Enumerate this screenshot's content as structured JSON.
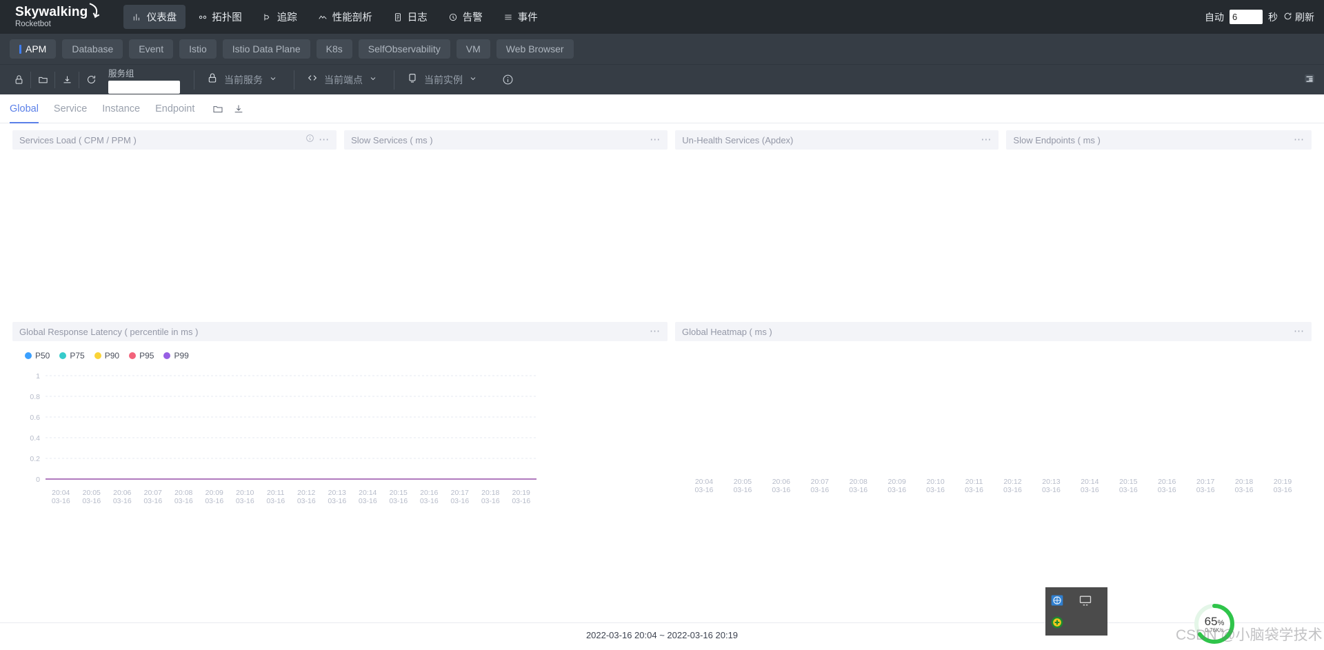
{
  "header": {
    "brand_name": "Skywalking",
    "brand_sub": "Rocketbot",
    "nav": [
      {
        "label": "仪表盘",
        "icon": "dashboard-icon",
        "active": true
      },
      {
        "label": "拓扑图",
        "icon": "topology-icon",
        "active": false
      },
      {
        "label": "追踪",
        "icon": "trace-icon",
        "active": false
      },
      {
        "label": "性能剖析",
        "icon": "profile-icon",
        "active": false
      },
      {
        "label": "日志",
        "icon": "log-icon",
        "active": false
      },
      {
        "label": "告警",
        "icon": "alarm-icon",
        "active": false
      },
      {
        "label": "事件",
        "icon": "event-icon",
        "active": false
      }
    ],
    "auto_label": "自动",
    "auto_value": "6",
    "seconds_label": "秒",
    "refresh_label": "刷新",
    "refresh_icon": "refresh-icon"
  },
  "categories": [
    {
      "label": "APM",
      "active": true
    },
    {
      "label": "Database",
      "active": false
    },
    {
      "label": "Event",
      "active": false
    },
    {
      "label": "Istio",
      "active": false
    },
    {
      "label": "Istio Data Plane",
      "active": false
    },
    {
      "label": "K8s",
      "active": false
    },
    {
      "label": "SelfObservability",
      "active": false
    },
    {
      "label": "VM",
      "active": false
    },
    {
      "label": "Web Browser",
      "active": false
    }
  ],
  "toolbar": {
    "icons": [
      "lock-icon",
      "folder-icon",
      "download-icon",
      "reload-icon"
    ],
    "service_group_label": "服务组",
    "service_group_value": "",
    "selectors": [
      {
        "label": "当前服务",
        "icon": "lock-icon"
      },
      {
        "label": "当前端点",
        "icon": "code-icon"
      },
      {
        "label": "当前实例",
        "icon": "instance-icon"
      }
    ],
    "info_icon": "info-icon",
    "layout_icon": "layout-panel-icon"
  },
  "subtabs": {
    "tabs": [
      {
        "label": "Global",
        "active": true
      },
      {
        "label": "Service",
        "active": false
      },
      {
        "label": "Instance",
        "active": false
      },
      {
        "label": "Endpoint",
        "active": false
      }
    ],
    "icons": [
      "folder-icon",
      "download-icon"
    ]
  },
  "widgets": {
    "row1": [
      {
        "title": "Services Load ( CPM / PPM )",
        "has_info": true
      },
      {
        "title": "Slow Services ( ms )",
        "has_info": false
      },
      {
        "title": "Un-Health Services (Apdex)",
        "has_info": false
      },
      {
        "title": "Slow Endpoints ( ms )",
        "has_info": false
      }
    ],
    "row2": [
      {
        "title": "Global Response Latency ( percentile in ms )",
        "has_info": false
      },
      {
        "title": "Global Heatmap ( ms )",
        "has_info": false
      }
    ],
    "menu_icon": "more-icon"
  },
  "footer": {
    "time_range": "2022-03-16 20:04 ~ 2022-03-16 20:19"
  },
  "overlay": {
    "tray_icons": [
      "network-icon",
      "display-icon",
      "security-shield-icon"
    ],
    "ring_percent": "65",
    "ring_percent_symbol": "%",
    "ring_sub": "0.76K/s",
    "watermark": "CSDN @小脑袋学技术",
    "ring_color": "#2fc44a"
  },
  "chart_data": {
    "type": "line",
    "title": "Global Response Latency ( percentile in ms )",
    "xlabel": "",
    "ylabel": "",
    "ylim": [
      0,
      1
    ],
    "yticks": [
      "0",
      "0.2",
      "0.4",
      "0.6",
      "0.8",
      "1"
    ],
    "grid": true,
    "legend_position": "top-left",
    "x": [
      "20:04\n03-16",
      "20:05\n03-16",
      "20:06\n03-16",
      "20:07\n03-16",
      "20:08\n03-16",
      "20:09\n03-16",
      "20:10\n03-16",
      "20:11\n03-16",
      "20:12\n03-16",
      "20:13\n03-16",
      "20:14\n03-16",
      "20:15\n03-16",
      "20:16\n03-16",
      "20:17\n03-16",
      "20:18\n03-16",
      "20:19\n03-16"
    ],
    "series": [
      {
        "name": "P50",
        "color": "#3aa0ff",
        "values": [
          0,
          0,
          0,
          0,
          0,
          0,
          0,
          0,
          0,
          0,
          0,
          0,
          0,
          0,
          0,
          0
        ]
      },
      {
        "name": "P75",
        "color": "#36cbcb",
        "values": [
          0,
          0,
          0,
          0,
          0,
          0,
          0,
          0,
          0,
          0,
          0,
          0,
          0,
          0,
          0,
          0
        ]
      },
      {
        "name": "P90",
        "color": "#fad337",
        "values": [
          0,
          0,
          0,
          0,
          0,
          0,
          0,
          0,
          0,
          0,
          0,
          0,
          0,
          0,
          0,
          0
        ]
      },
      {
        "name": "P95",
        "color": "#f2637b",
        "values": [
          0,
          0,
          0,
          0,
          0,
          0,
          0,
          0,
          0,
          0,
          0,
          0,
          0,
          0,
          0,
          0
        ]
      },
      {
        "name": "P99",
        "color": "#975fe4",
        "values": [
          0,
          0,
          0,
          0,
          0,
          0,
          0,
          0,
          0,
          0,
          0,
          0,
          0,
          0,
          0,
          0
        ]
      }
    ]
  },
  "heatmap_data": {
    "type": "heatmap",
    "title": "Global Heatmap ( ms )",
    "x": [
      "20:04\n03-16",
      "20:05\n03-16",
      "20:06\n03-16",
      "20:07\n03-16",
      "20:08\n03-16",
      "20:09\n03-16",
      "20:10\n03-16",
      "20:11\n03-16",
      "20:12\n03-16",
      "20:13\n03-16",
      "20:14\n03-16",
      "20:15\n03-16",
      "20:16\n03-16",
      "20:17\n03-16",
      "20:18\n03-16",
      "20:19\n03-16"
    ],
    "values": []
  }
}
